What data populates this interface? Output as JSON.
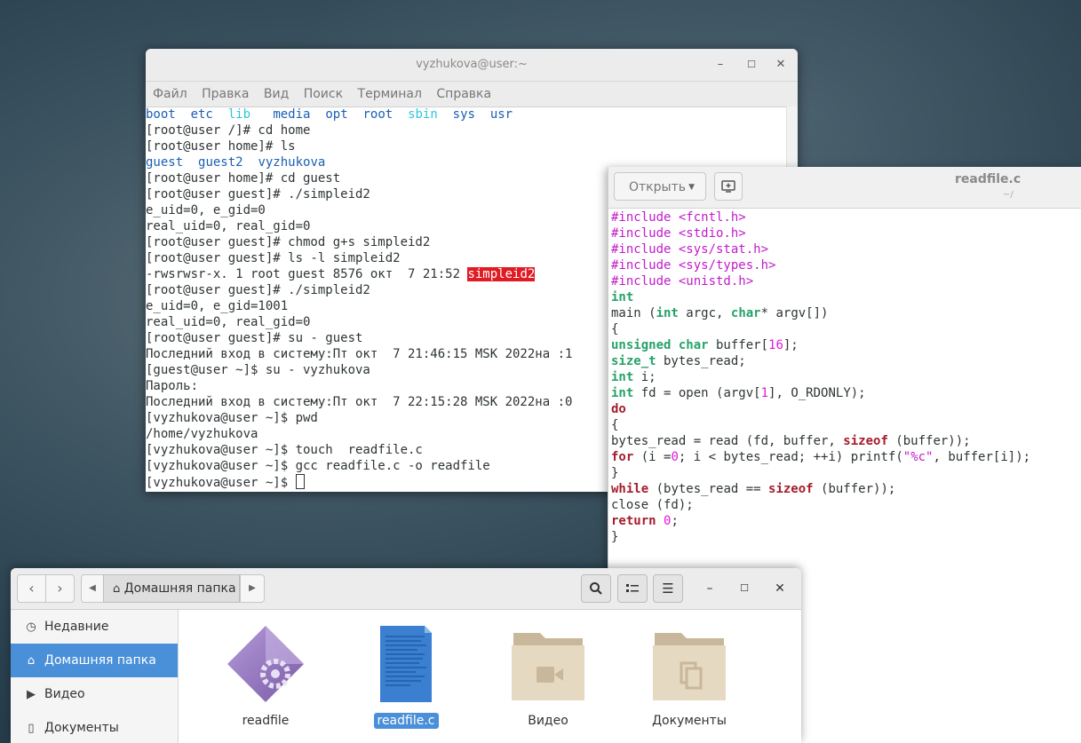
{
  "terminal": {
    "title": "vyzhukova@user:~",
    "controls": {
      "minimize": "–",
      "maximize": "☐",
      "close": "✕"
    },
    "menu": [
      "Файл",
      "Правка",
      "Вид",
      "Поиск",
      "Терминал",
      "Справка"
    ],
    "lines": {
      "l0_dirs": [
        "boot",
        "etc",
        "lib",
        "media",
        "opt",
        "root",
        "sbin",
        "sys",
        "usr"
      ],
      "l1": "[root@user /]# cd home",
      "l2": "[root@user home]# ls",
      "l3_dirs": [
        "guest",
        "guest2",
        "vyzhukova"
      ],
      "l4": "[root@user home]# cd guest",
      "l5": "[root@user guest]# ./simpleid2",
      "l6": "e_uid=0, e_gid=0",
      "l7": "real_uid=0, real_gid=0",
      "l8": "[root@user guest]# chmod g+s simpleid2",
      "l9": "[root@user guest]# ls -l simpleid2",
      "l10_prefix": "-rwsrwsr-x. 1 root guest 8576 окт  7 21:52 ",
      "l10_file": "simpleid2",
      "l11": "[root@user guest]# ./simpleid2",
      "l12": "e_uid=0, e_gid=1001",
      "l13": "real_uid=0, real_gid=0",
      "l14": "[root@user guest]# su - guest",
      "l15": "Последний вход в систему:Пт окт  7 21:46:15 MSK 2022на :1",
      "l16": "[guest@user ~]$ su - vyzhukova",
      "l17": "Пароль:",
      "l18": "Последний вход в систему:Пт окт  7 22:15:28 MSK 2022на :0",
      "l19": "[vyzhukova@user ~]$ pwd",
      "l20": "/home/vyzhukova",
      "l21": "[vyzhukova@user ~]$ touch  readfile.c",
      "l22": "[vyzhukova@user ~]$ gcc readfile.c -o readfile",
      "l23": "[vyzhukova@user ~]$ "
    }
  },
  "editor": {
    "open_label": "Открыть",
    "title": "readfile.c",
    "subtitle": "~/"
  },
  "file_manager": {
    "breadcrumb_home": "Домашняя папка",
    "sidebar": [
      {
        "icon": "clock-icon",
        "label": "Недавние"
      },
      {
        "icon": "home-icon",
        "label": "Домашняя папка"
      },
      {
        "icon": "video-icon",
        "label": "Видео"
      },
      {
        "icon": "document-icon",
        "label": "Документы"
      }
    ],
    "files": [
      {
        "icon": "executable-icon",
        "label": "readfile"
      },
      {
        "icon": "text-file-icon",
        "label": "readfile.c"
      },
      {
        "icon": "folder-video-icon",
        "label": "Видео"
      },
      {
        "icon": "folder-documents-icon",
        "label": "Документы"
      }
    ]
  },
  "colors": {
    "selection": "#4a90d9",
    "terminal_dir": "#1a5fb4",
    "terminal_link": "#2ec6d9",
    "terminal_highlight": "#e01b24"
  }
}
